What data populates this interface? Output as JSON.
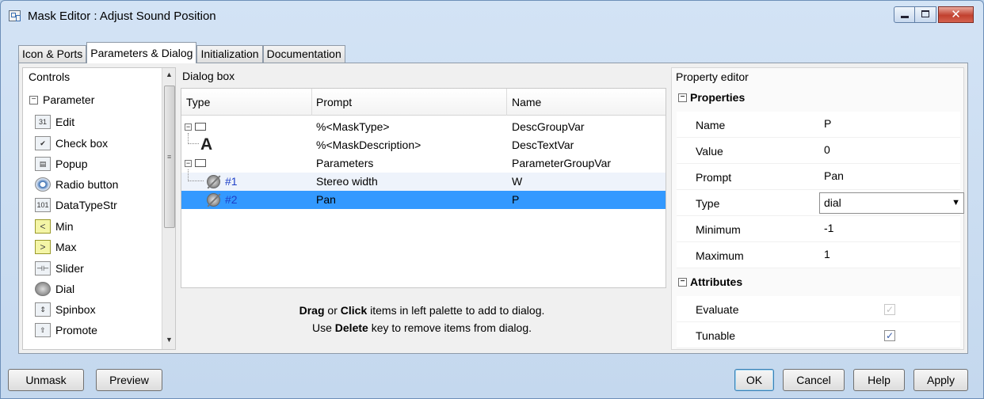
{
  "window": {
    "title": "Mask Editor : Adjust Sound Position"
  },
  "tabs": [
    {
      "label": "Icon & Ports",
      "active": false
    },
    {
      "label": "Parameters & Dialog",
      "active": true
    },
    {
      "label": "Initialization",
      "active": false
    },
    {
      "label": "Documentation",
      "active": false
    }
  ],
  "controls": {
    "header": "Controls",
    "group": "Parameter",
    "items": [
      {
        "label": "Edit",
        "icon": "edit-icon",
        "glyph": "31"
      },
      {
        "label": "Check box",
        "icon": "checkbox-icon",
        "glyph": "✔"
      },
      {
        "label": "Popup",
        "icon": "popup-icon",
        "glyph": "▤"
      },
      {
        "label": "Radio button",
        "icon": "radio-icon",
        "glyph": ""
      },
      {
        "label": "DataTypeStr",
        "icon": "datatype-icon",
        "glyph": "101"
      },
      {
        "label": "Min",
        "icon": "min-icon",
        "glyph": "<"
      },
      {
        "label": "Max",
        "icon": "max-icon",
        "glyph": ">"
      },
      {
        "label": "Slider",
        "icon": "slider-icon",
        "glyph": "⊣⊢"
      },
      {
        "label": "Dial",
        "icon": "dial-icon",
        "glyph": ""
      },
      {
        "label": "Spinbox",
        "icon": "spinbox-icon",
        "glyph": "⇕"
      },
      {
        "label": "Promote",
        "icon": "promote-icon",
        "glyph": "⇧"
      }
    ]
  },
  "dialog_box": {
    "header": "Dialog box",
    "columns": [
      "Type",
      "Prompt",
      "Name"
    ],
    "rows": [
      {
        "type": "",
        "prompt": "%<MaskType>",
        "name": "DescGroupVar"
      },
      {
        "type": "",
        "prompt": "%<MaskDescription>",
        "name": "DescTextVar"
      },
      {
        "type": "",
        "prompt": "Parameters",
        "name": "ParameterGroupVar"
      },
      {
        "type": "#1",
        "prompt": "Stereo width",
        "name": "W"
      },
      {
        "type": "#2",
        "prompt": "Pan",
        "name": "P"
      }
    ],
    "hint": {
      "line1_a": "Drag",
      "line1_b": " or ",
      "line1_c": "Click",
      "line1_d": " items in left palette to add to dialog.",
      "line2_a": "Use ",
      "line2_b": "Delete",
      "line2_c": " key to remove items from dialog."
    }
  },
  "property_editor": {
    "header": "Property editor",
    "properties_label": "Properties",
    "properties": [
      {
        "key": "Name",
        "value": "P"
      },
      {
        "key": "Value",
        "value": "0"
      },
      {
        "key": "Prompt",
        "value": "Pan"
      },
      {
        "key": "Type",
        "value": "dial"
      },
      {
        "key": "Minimum",
        "value": "-1"
      },
      {
        "key": "Maximum",
        "value": "1"
      }
    ],
    "attributes_label": "Attributes",
    "attributes": [
      {
        "key": "Evaluate",
        "checked": true,
        "enabled": false
      },
      {
        "key": "Tunable",
        "checked": true,
        "enabled": true
      }
    ]
  },
  "buttons": {
    "unmask": "Unmask",
    "preview": "Preview",
    "ok": "OK",
    "cancel": "Cancel",
    "help": "Help",
    "apply": "Apply"
  },
  "colors": {
    "selection": "#3399ff",
    "type_number": "#1d3fc8"
  }
}
